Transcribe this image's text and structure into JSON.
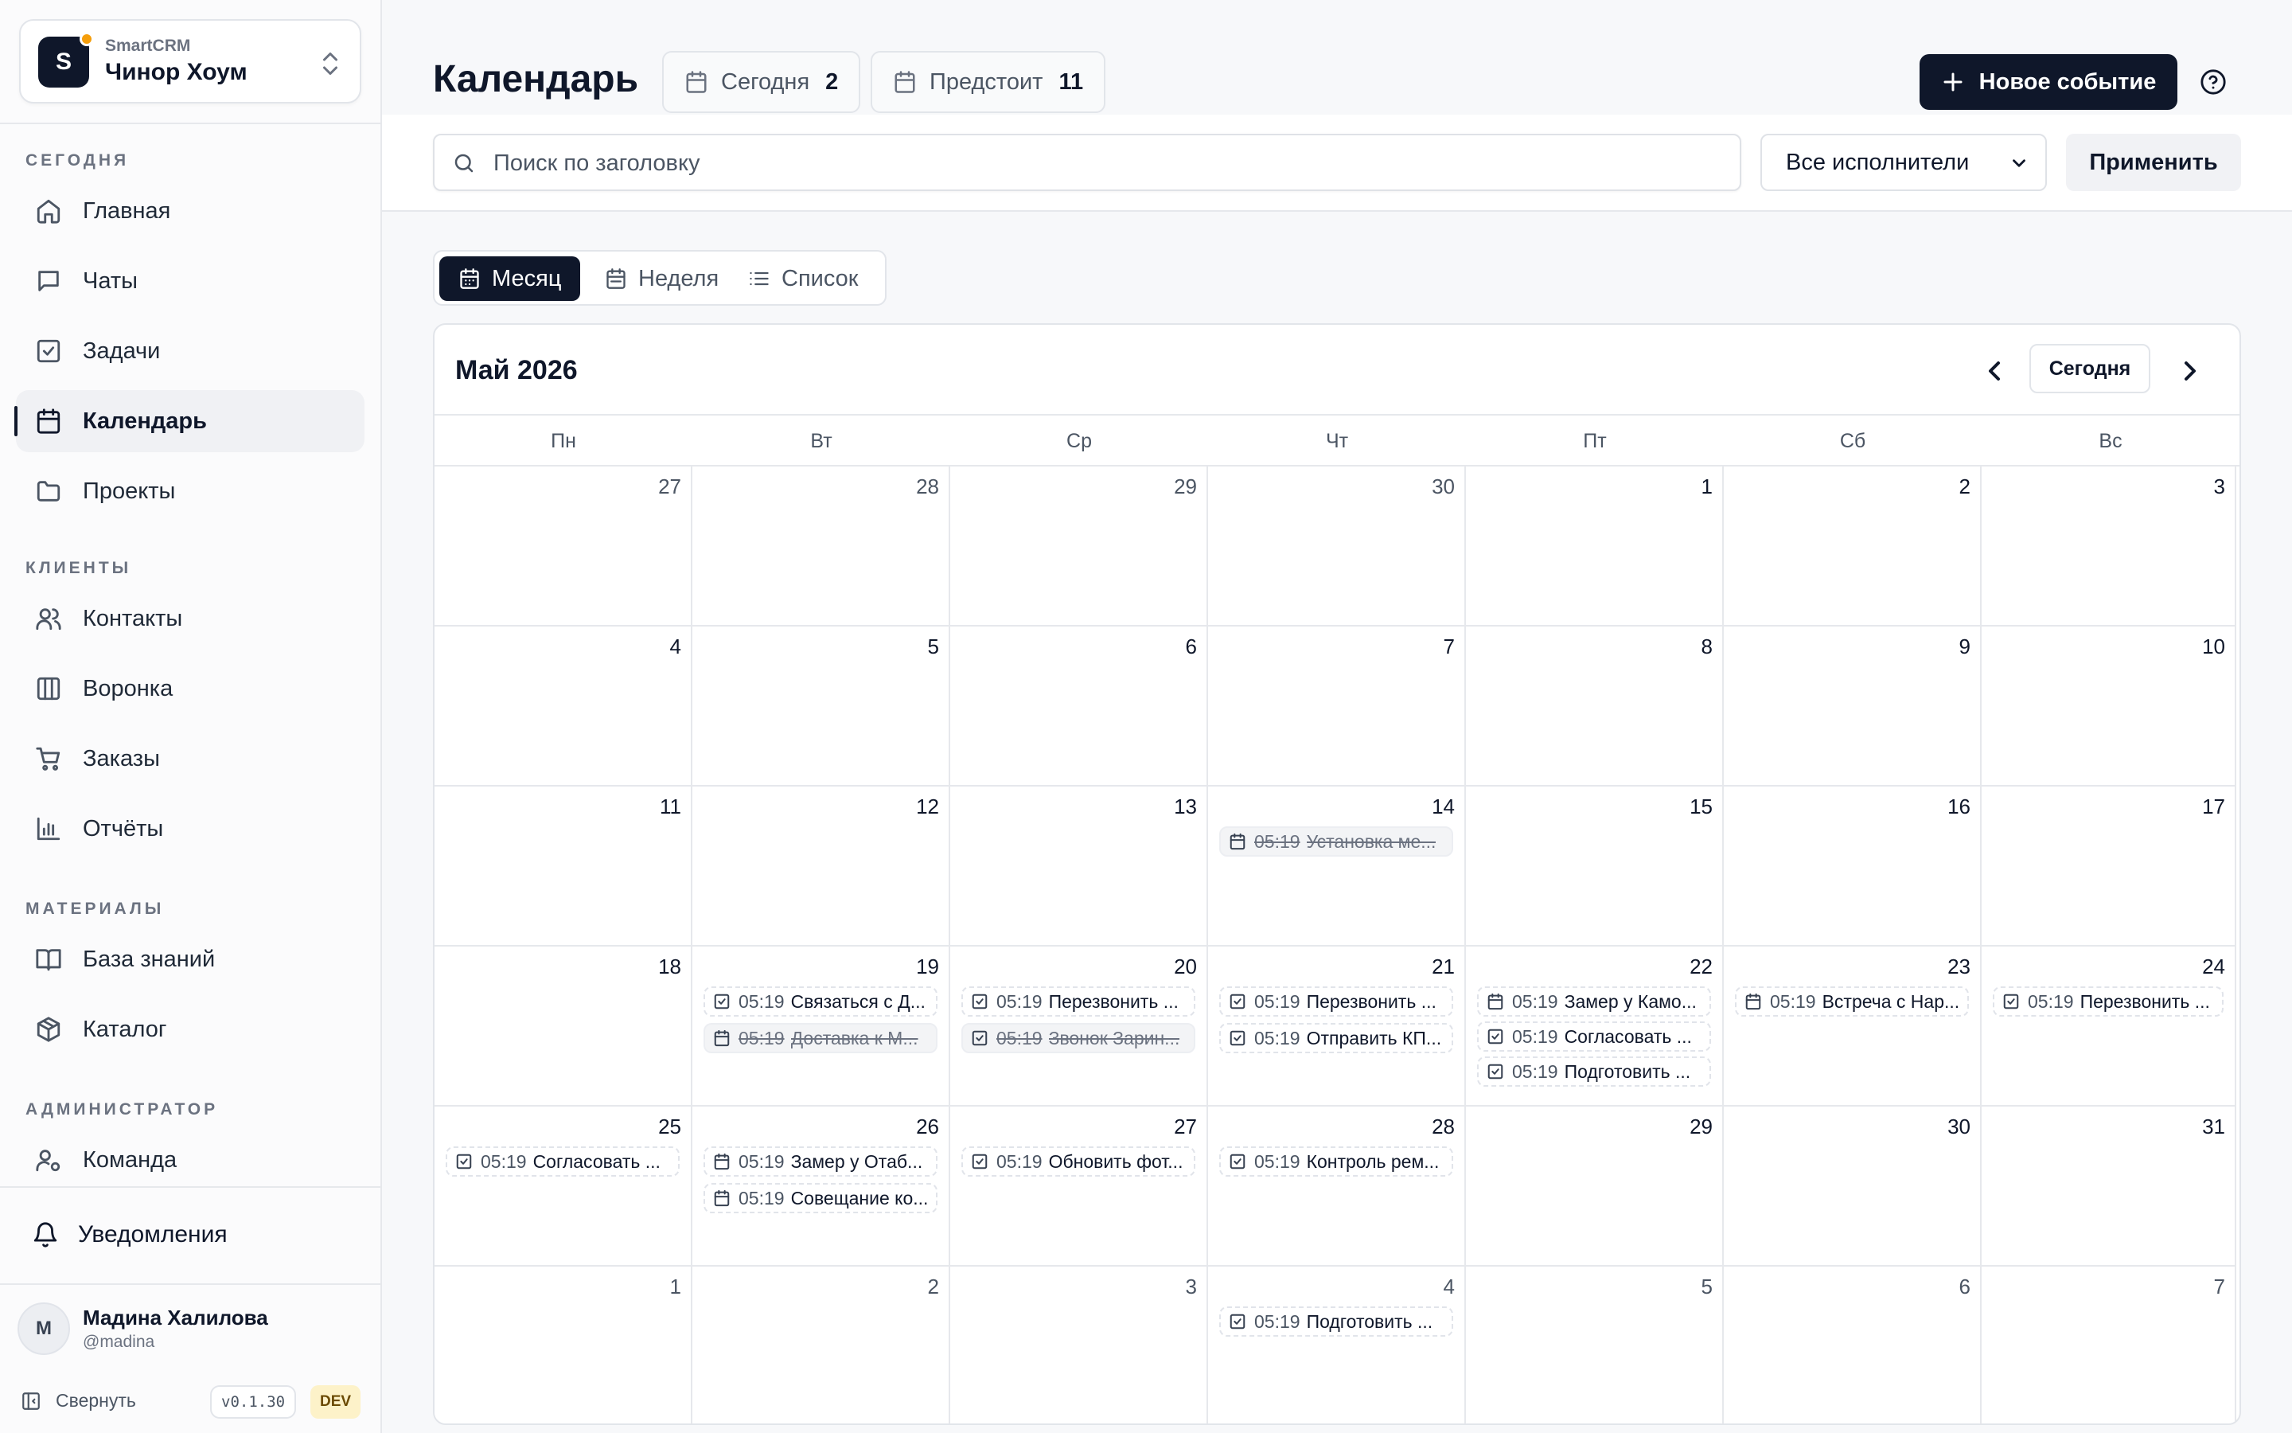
{
  "workspace": {
    "brand": "SmartCRM",
    "name": "Чинор Хоум",
    "logo_letter": "S"
  },
  "sidebar": {
    "sections": [
      {
        "title": "СЕГОДНЯ",
        "items": [
          {
            "label": "Главная",
            "icon": "home-icon"
          },
          {
            "label": "Чаты",
            "icon": "chat-icon"
          },
          {
            "label": "Задачи",
            "icon": "task-icon"
          },
          {
            "label": "Календарь",
            "icon": "calendar-icon",
            "active": true
          },
          {
            "label": "Проекты",
            "icon": "folder-icon"
          }
        ]
      },
      {
        "title": "КЛИЕНТЫ",
        "items": [
          {
            "label": "Контакты",
            "icon": "users-icon"
          },
          {
            "label": "Воронка",
            "icon": "kanban-icon"
          },
          {
            "label": "Заказы",
            "icon": "cart-icon"
          },
          {
            "label": "Отчёты",
            "icon": "chart-icon"
          }
        ]
      },
      {
        "title": "МАТЕРИАЛЫ",
        "items": [
          {
            "label": "База знаний",
            "icon": "book-icon"
          },
          {
            "label": "Каталог",
            "icon": "package-icon"
          }
        ]
      },
      {
        "title": "АДМИНИСТРАТОР",
        "items": [
          {
            "label": "Команда",
            "icon": "user-cog-icon"
          }
        ]
      }
    ],
    "notifications_label": "Уведомления",
    "user": {
      "initial": "М",
      "name": "Мадина Халилова",
      "handle": "@madina"
    },
    "collapse_label": "Свернуть",
    "version": "v0.1.30",
    "env_badge": "DEV"
  },
  "header": {
    "title": "Календарь",
    "today_chip": {
      "label": "Сегодня",
      "count": "2"
    },
    "upcoming_chip": {
      "label": "Предстоит",
      "count": "11"
    },
    "new_event_label": "Новое событие"
  },
  "filters": {
    "search_placeholder": "Поиск по заголовку",
    "search_value": "",
    "performer_selected": "Все исполнители",
    "apply_label": "Применить"
  },
  "view_tabs": [
    {
      "label": "Месяц",
      "icon": "calendar-icon",
      "active": true
    },
    {
      "label": "Неделя",
      "icon": "calendar-week-icon",
      "active": false
    },
    {
      "label": "Список",
      "icon": "list-icon",
      "active": false
    }
  ],
  "calendar": {
    "month_title": "Май 2026",
    "today_button": "Сегодня",
    "weekdays": [
      "Пн",
      "Вт",
      "Ср",
      "Чт",
      "Пт",
      "Сб",
      "Вс"
    ],
    "weeks": [
      [
        {
          "day": "27",
          "other": true
        },
        {
          "day": "28",
          "other": true
        },
        {
          "day": "29",
          "other": true
        },
        {
          "day": "30",
          "other": true
        },
        {
          "day": "1"
        },
        {
          "day": "2"
        },
        {
          "day": "3"
        }
      ],
      [
        {
          "day": "4"
        },
        {
          "day": "5"
        },
        {
          "day": "6"
        },
        {
          "day": "7"
        },
        {
          "day": "8"
        },
        {
          "day": "9"
        },
        {
          "day": "10"
        }
      ],
      [
        {
          "day": "11"
        },
        {
          "day": "12"
        },
        {
          "day": "13"
        },
        {
          "day": "14",
          "events": [
            {
              "time": "05:19",
              "title": "Установка ме...",
              "type": "event",
              "done": true
            }
          ]
        },
        {
          "day": "15"
        },
        {
          "day": "16"
        },
        {
          "day": "17"
        }
      ],
      [
        {
          "day": "18"
        },
        {
          "day": "19",
          "events": [
            {
              "time": "05:19",
              "title": "Связаться с Д...",
              "type": "task"
            },
            {
              "time": "05:19",
              "title": "Доставка к М...",
              "type": "event",
              "done": true
            }
          ]
        },
        {
          "day": "20",
          "events": [
            {
              "time": "05:19",
              "title": "Перезвонить ...",
              "type": "task"
            },
            {
              "time": "05:19",
              "title": "Звонок Зарин...",
              "type": "task",
              "done": true
            }
          ]
        },
        {
          "day": "21",
          "events": [
            {
              "time": "05:19",
              "title": "Перезвонить ...",
              "type": "task"
            },
            {
              "time": "05:19",
              "title": "Отправить КП...",
              "type": "task"
            }
          ]
        },
        {
          "day": "22",
          "events": [
            {
              "time": "05:19",
              "title": "Замер у Камо...",
              "type": "event"
            },
            {
              "time": "05:19",
              "title": "Согласовать ...",
              "type": "task"
            },
            {
              "time": "05:19",
              "title": "Подготовить ...",
              "type": "task"
            }
          ]
        },
        {
          "day": "23",
          "events": [
            {
              "time": "05:19",
              "title": "Встреча с Нар...",
              "type": "event"
            }
          ]
        },
        {
          "day": "24",
          "events": [
            {
              "time": "05:19",
              "title": "Перезвонить ...",
              "type": "task"
            }
          ]
        }
      ],
      [
        {
          "day": "25",
          "events": [
            {
              "time": "05:19",
              "title": "Согласовать ...",
              "type": "task"
            }
          ]
        },
        {
          "day": "26",
          "events": [
            {
              "time": "05:19",
              "title": "Замер у Отаб...",
              "type": "event"
            },
            {
              "time": "05:19",
              "title": "Совещание ко...",
              "type": "event"
            }
          ]
        },
        {
          "day": "27",
          "events": [
            {
              "time": "05:19",
              "title": "Обновить фот...",
              "type": "task"
            }
          ]
        },
        {
          "day": "28",
          "events": [
            {
              "time": "05:19",
              "title": "Контроль рем...",
              "type": "task"
            }
          ]
        },
        {
          "day": "29"
        },
        {
          "day": "30"
        },
        {
          "day": "31"
        }
      ],
      [
        {
          "day": "1",
          "other": true
        },
        {
          "day": "2",
          "other": true
        },
        {
          "day": "3",
          "other": true
        },
        {
          "day": "4",
          "other": true,
          "events": [
            {
              "time": "05:19",
              "title": "Подготовить ...",
              "type": "task"
            }
          ]
        },
        {
          "day": "5",
          "other": true
        },
        {
          "day": "6",
          "other": true
        },
        {
          "day": "7",
          "other": true
        }
      ]
    ]
  },
  "colors": {
    "primary": "#0f172a",
    "accent_dot": "#f59e0b",
    "dev_badge_bg": "#fdf2c9"
  }
}
